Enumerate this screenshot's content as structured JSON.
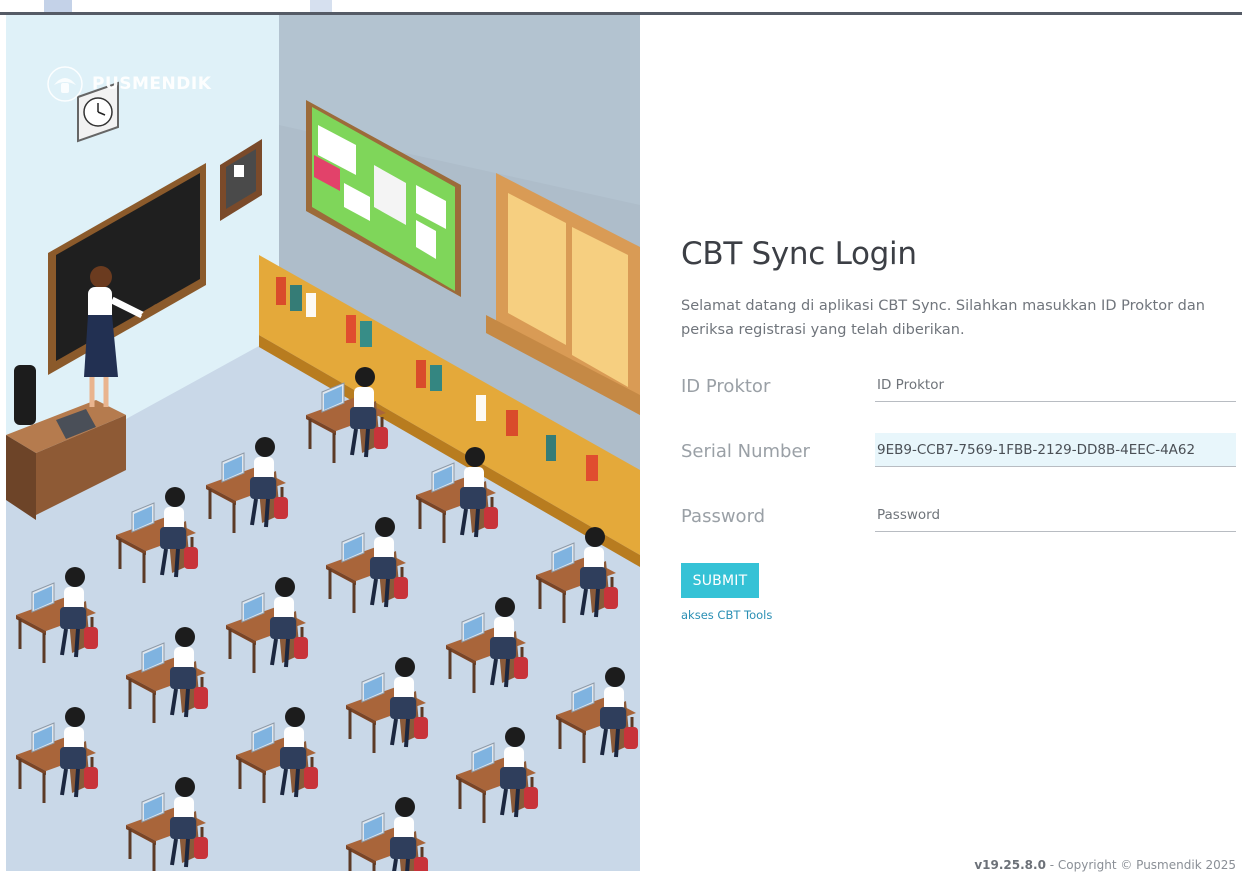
{
  "brand": {
    "name": "PUSMENDIK"
  },
  "login": {
    "title": "CBT Sync Login",
    "intro": "Selamat datang di aplikasi CBT Sync. Silahkan masukkan ID Proktor dan periksa registrasi yang telah diberikan.",
    "fields": [
      {
        "label": "ID Proktor",
        "placeholder": "ID Proktor",
        "value": ""
      },
      {
        "label": "Serial Number",
        "placeholder": "Serial Number",
        "value": "9EB9-CCB7-7569-1FBB-2129-DD8B-4EEC-4A62"
      },
      {
        "label": "Password",
        "placeholder": "Password",
        "value": ""
      }
    ],
    "submit_label": "SUBMIT",
    "tools_link": "akses CBT Tools"
  },
  "footer": {
    "version": "v19.25.8.0",
    "copyright": " - Copyright © Pusmendik 2025"
  },
  "colors": {
    "accent": "#35c2d6",
    "link": "#2a8fb4",
    "wall_left": "#dff1f8",
    "wall_back": "#aebdca",
    "floor": "#c9d8e8"
  },
  "icons": [
    "garuda-logo-icon",
    "clock-icon"
  ]
}
